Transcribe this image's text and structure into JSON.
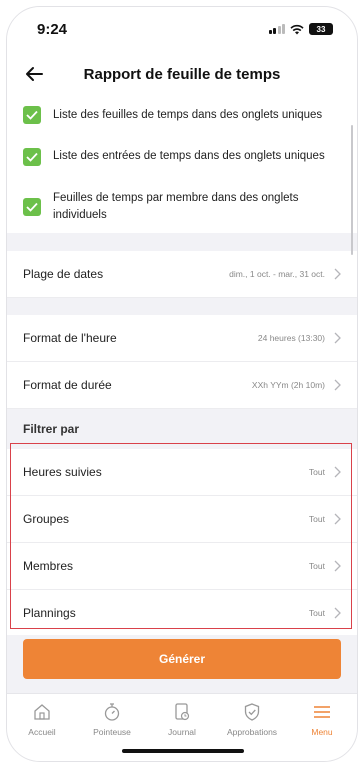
{
  "status": {
    "time": "9:24",
    "battery": "33"
  },
  "header": {
    "title": "Rapport de feuille de temps"
  },
  "options": [
    {
      "label": "Liste des feuilles de temps dans des onglets uniques",
      "checked": true
    },
    {
      "label": "Liste des entrées de temps dans des onglets uniques",
      "checked": true
    },
    {
      "label": "Feuilles de temps par membre dans des onglets individuels",
      "checked": true
    }
  ],
  "date_range": {
    "label": "Plage de dates",
    "value": "dim., 1 oct. - mar., 31 oct."
  },
  "hour_format": {
    "label": "Format de l'heure",
    "value": "24 heures (13:30)"
  },
  "duration_format": {
    "label": "Format de durée",
    "value": "XXh YYm (2h 10m)"
  },
  "filter": {
    "title": "Filtrer par",
    "items": [
      {
        "label": "Heures suivies",
        "value": "Tout"
      },
      {
        "label": "Groupes",
        "value": "Tout"
      },
      {
        "label": "Membres",
        "value": "Tout"
      },
      {
        "label": "Plannings",
        "value": "Tout"
      }
    ]
  },
  "generate_label": "Générer",
  "tabs": [
    {
      "label": "Accueil",
      "icon": "home-icon"
    },
    {
      "label": "Pointeuse",
      "icon": "stopwatch-icon"
    },
    {
      "label": "Journal",
      "icon": "journal-icon"
    },
    {
      "label": "Approbations",
      "icon": "shield-check-icon"
    },
    {
      "label": "Menu",
      "icon": "menu-icon",
      "active": true
    }
  ],
  "colors": {
    "accent": "#ee8436",
    "check": "#6cc04a",
    "highlight": "#d9414a"
  }
}
